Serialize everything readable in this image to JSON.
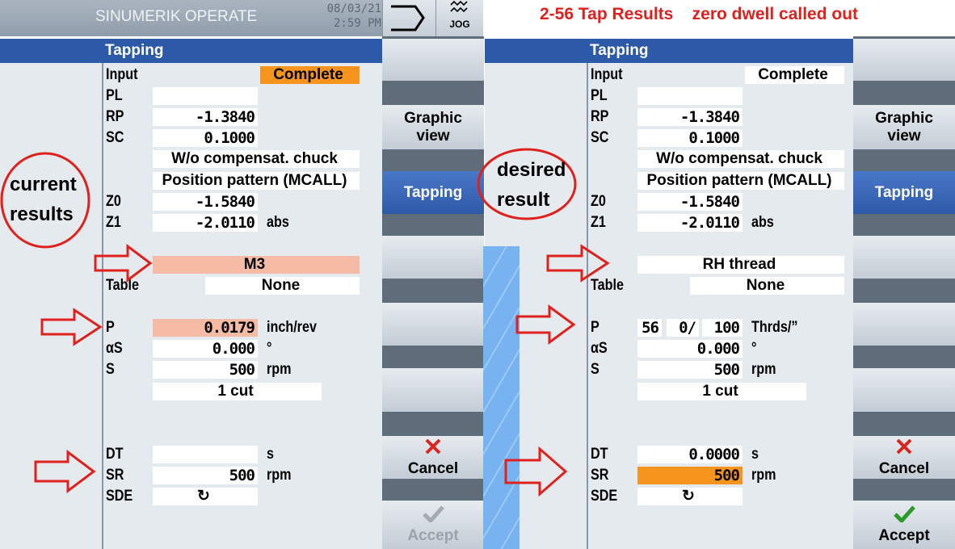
{
  "header": {
    "app_title": "SINUMERIK OPERATE",
    "date": "08/03/21",
    "time": "2:59 PM",
    "jog_label": "JOG"
  },
  "note": {
    "text": "2-56 Tap Results    zero dwell called out"
  },
  "annotations": {
    "left": [
      "current",
      "results"
    ],
    "right": [
      "desired",
      "result"
    ],
    "color": "#e0201c"
  },
  "panels": [
    {
      "title": "Tapping",
      "rows": [
        {
          "label": "Input",
          "value": "Complete",
          "wide": true,
          "hl": "#f7941d"
        },
        {
          "label": "PL",
          "value": ""
        },
        {
          "label": "RP",
          "value": "-1.3840"
        },
        {
          "label": "SC",
          "value": "0.1000"
        },
        {
          "label": "",
          "value": "W/o compensat. chuck",
          "wide": true
        },
        {
          "label": "",
          "value": "Position pattern (MCALL)",
          "wide": true
        },
        {
          "label": "Z0",
          "value": "-1.5840"
        },
        {
          "label": "Z1",
          "value": "-2.0110",
          "unit": "abs"
        },
        null,
        {
          "label": "",
          "value": "M3",
          "wide": true,
          "hl": "#f6bba5",
          "full": true
        },
        {
          "label": "Table",
          "value": "None",
          "table": true
        },
        null,
        {
          "label": "P",
          "value": "0.0179",
          "unit": "inch/rev",
          "hl": "#f6bba5"
        },
        {
          "label": "αS",
          "value": "0.000",
          "unit": "°"
        },
        {
          "label": "S",
          "value": "500",
          "unit": "rpm"
        },
        {
          "label": "",
          "value": "1 cut",
          "cut": true
        },
        null,
        null,
        {
          "label": "DT",
          "value": "",
          "unit": "s"
        },
        {
          "label": "SR",
          "value": "500",
          "unit": "rpm"
        },
        {
          "label": "SDE",
          "value": "↻",
          "c": true
        }
      ],
      "softkeys": [
        {
          "label": ""
        },
        {
          "label": "Graphic\nview"
        },
        {
          "label": "Tapping",
          "active": true
        },
        {
          "label": ""
        },
        {
          "label": ""
        },
        {
          "label": ""
        },
        {
          "label": "Cancel",
          "icon": "cancel"
        },
        {
          "label": "Accept",
          "icon": "accept",
          "disabled": true
        }
      ]
    },
    {
      "title": "Tapping",
      "rows": [
        {
          "label": "Input",
          "value": "Complete",
          "wide": true
        },
        {
          "label": "PL",
          "value": ""
        },
        {
          "label": "RP",
          "value": "-1.3840"
        },
        {
          "label": "SC",
          "value": "0.1000"
        },
        {
          "label": "",
          "value": "W/o compensat. chuck",
          "wide": true
        },
        {
          "label": "",
          "value": "Position pattern (MCALL)",
          "wide": true
        },
        {
          "label": "Z0",
          "value": "-1.5840"
        },
        {
          "label": "Z1",
          "value": "-2.0110",
          "unit": "abs"
        },
        null,
        {
          "label": "",
          "value": "RH thread",
          "wide": true,
          "full": true
        },
        {
          "label": "Table",
          "value": "None",
          "table": true
        },
        null,
        {
          "label": "P",
          "pitch": [
            "56",
            "0/",
            "100"
          ],
          "unit": "Thrds/”"
        },
        {
          "label": "αS",
          "value": "0.000",
          "unit": "°"
        },
        {
          "label": "S",
          "value": "500",
          "unit": "rpm"
        },
        {
          "label": "",
          "value": "1 cut",
          "cut": true
        },
        null,
        null,
        {
          "label": "DT",
          "value": "0.0000",
          "unit": "s"
        },
        {
          "label": "SR",
          "value": "500",
          "unit": "rpm",
          "hl": "#f7941d"
        },
        {
          "label": "SDE",
          "value": "↻",
          "c": true
        }
      ],
      "softkeys": [
        {
          "label": ""
        },
        {
          "label": "Graphic\nview"
        },
        {
          "label": "Tapping",
          "active": true
        },
        {
          "label": ""
        },
        {
          "label": ""
        },
        {
          "label": ""
        },
        {
          "label": "Cancel",
          "icon": "cancel"
        },
        {
          "label": "Accept",
          "icon": "accept"
        }
      ]
    }
  ]
}
